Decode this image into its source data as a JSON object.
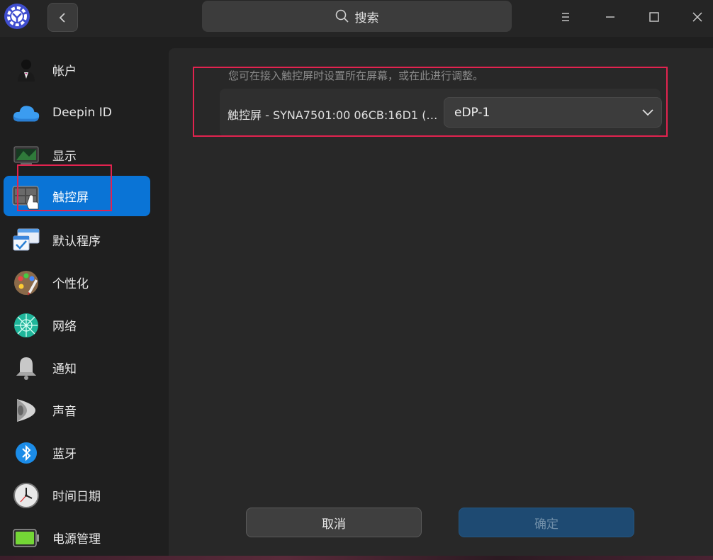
{
  "titlebar": {
    "search_label": "搜索",
    "icons": {
      "logo": "settings-gear-logo-icon",
      "back": "chevron-left-icon",
      "search": "search-icon",
      "menu": "menu-icon",
      "minimize": "minimize-icon",
      "maximize": "maximize-icon",
      "close": "close-icon"
    }
  },
  "sidebar": {
    "items": [
      {
        "label": "帐户",
        "icon": "account-icon"
      },
      {
        "label": "Deepin ID",
        "icon": "cloud-icon"
      },
      {
        "label": "显示",
        "icon": "display-icon"
      },
      {
        "label": "触控屏",
        "icon": "touchscreen-icon",
        "active": true
      },
      {
        "label": "默认程序",
        "icon": "default-apps-icon"
      },
      {
        "label": "个性化",
        "icon": "personalization-palette-icon"
      },
      {
        "label": "网络",
        "icon": "network-icon"
      },
      {
        "label": "通知",
        "icon": "bell-icon"
      },
      {
        "label": "声音",
        "icon": "speaker-icon"
      },
      {
        "label": "蓝牙",
        "icon": "bluetooth-icon"
      },
      {
        "label": "时间日期",
        "icon": "clock-icon"
      },
      {
        "label": "电源管理",
        "icon": "battery-icon"
      }
    ],
    "active_color": "#0a74d6"
  },
  "content": {
    "hint": "您可在接入触控屏时设置所在屏幕，或在此进行调整。",
    "device_name": "触控屏 - SYNA7501:00 06CB:16D1 (…",
    "selected_output": "eDP-1",
    "cancel_label": "取消",
    "confirm_label": "确定"
  },
  "colors": {
    "highlight": "#e2234f",
    "accent": "#0a74d6"
  }
}
